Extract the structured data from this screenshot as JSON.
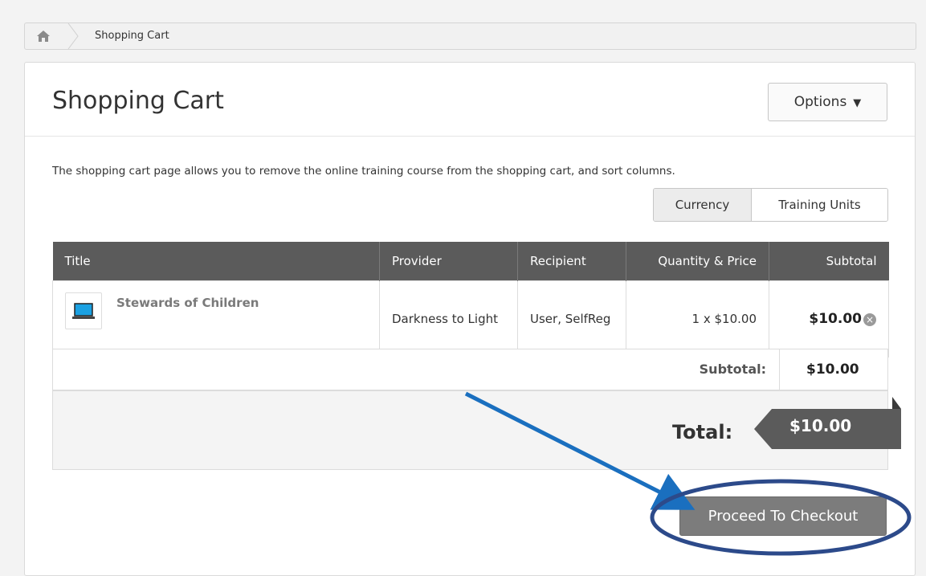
{
  "breadcrumb": {
    "home_icon": "home-icon",
    "current": "Shopping Cart"
  },
  "page": {
    "title": "Shopping Cart",
    "options_label": "Options"
  },
  "description": "The shopping cart page allows you to remove the online training course from the shopping cart, and sort columns.",
  "toggle": {
    "currency": "Currency",
    "training_units": "Training Units",
    "selected": "Currency"
  },
  "table": {
    "headers": [
      "Title",
      "Provider",
      "Recipient",
      "Quantity & Price",
      "Subtotal"
    ],
    "rows": [
      {
        "title": "Stewards of Children",
        "icon": "laptop-icon",
        "provider": "Darkness to Light",
        "recipient": "User, SelfReg",
        "qty_price": "1 x $10.00",
        "subtotal": "$10.00"
      }
    ]
  },
  "summary": {
    "subtotal_label": "Subtotal:",
    "subtotal_value": "$10.00",
    "total_label": "Total:",
    "total_value": "$10.00"
  },
  "checkout_label": "Proceed To Checkout",
  "colors": {
    "header_bg": "#5b5b5b",
    "button_bg": "#7c7c7c",
    "annotation_arrow": "#1a6fbf",
    "annotation_ellipse": "#2c4a8a"
  }
}
